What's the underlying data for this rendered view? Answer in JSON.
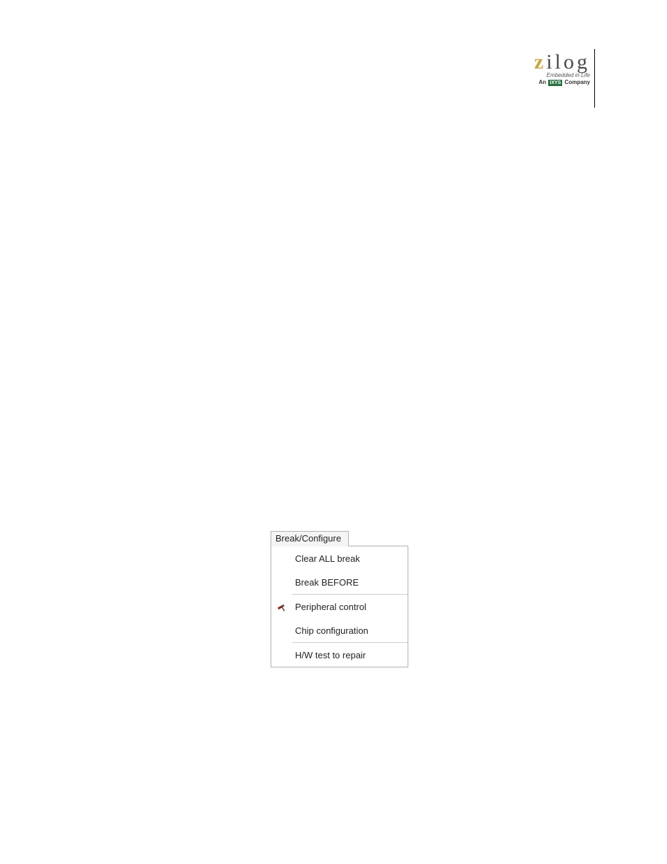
{
  "logo": {
    "brand_z": "z",
    "brand_rest": "ilog",
    "tagline": "Embedded in Life",
    "company_prefix": "An ",
    "company_box": "IXYS",
    "company_suffix": " Company"
  },
  "menu": {
    "tab_label": "Break/Configure",
    "items": [
      "Clear ALL break",
      "Break BEFORE",
      "Peripheral control",
      "Chip configuration",
      "H/W test to repair"
    ],
    "icon_row_index": 2,
    "icon_name": "hammer-icon"
  }
}
